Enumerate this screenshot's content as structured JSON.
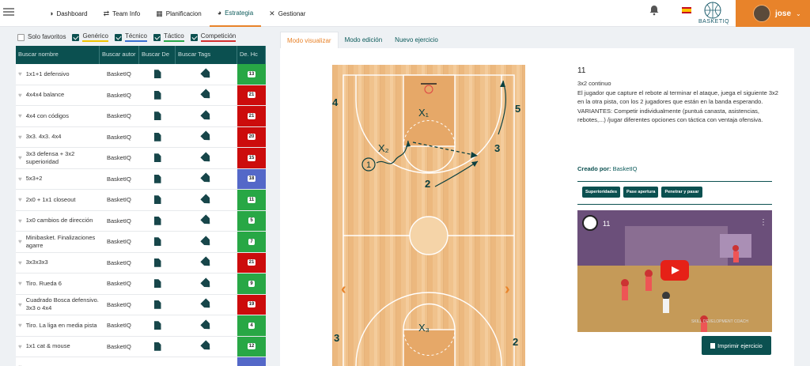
{
  "topbar": {
    "nav": [
      {
        "label": "Dashboard",
        "icon": "dashboard-icon",
        "glyph": "◑"
      },
      {
        "label": "Team Info",
        "icon": "team-info-icon",
        "glyph": "⇄"
      },
      {
        "label": "Planificacion",
        "icon": "calendar-icon",
        "glyph": "▦"
      },
      {
        "label": "Estrategia",
        "icon": "strategy-icon",
        "glyph": "◕"
      },
      {
        "label": "Gestionar",
        "icon": "tools-icon",
        "glyph": "✕"
      }
    ],
    "active_nav": "Estrategia",
    "logo_text": "BASKETIQ",
    "user_name": "jose",
    "user_caret": "⌄"
  },
  "filters": {
    "solo_favoritos": "Solo favoritos",
    "generico": "Genérico",
    "tecnico": "Técnico",
    "tactico": "Táctico",
    "competicion": "Competición"
  },
  "table": {
    "headers": [
      "Buscar nombre",
      "Buscar autor",
      "Buscar De",
      "Buscar Tags",
      "De. Hc"
    ],
    "rows": [
      {
        "name": "1x1+1 defensivo",
        "author": "BasketIQ",
        "difficulty": "13",
        "color": "#28a745"
      },
      {
        "name": "4x4x4 balance",
        "author": "BasketIQ",
        "difficulty": "21",
        "color": "#cc0c0c"
      },
      {
        "name": "4x4 con códigos",
        "author": "BasketIQ",
        "difficulty": "21",
        "color": "#cc0c0c"
      },
      {
        "name": "3x3. 4x3. 4x4",
        "author": "BasketIQ",
        "difficulty": "20",
        "color": "#cc0c0c"
      },
      {
        "name": "3x3 defensa + 3x2 superioridad",
        "author": "BasketIQ",
        "difficulty": "15",
        "color": "#cc0c0c"
      },
      {
        "name": "5x3+2",
        "author": "BasketIQ",
        "difficulty": "18",
        "color": "#5468c8"
      },
      {
        "name": "2x0 + 1x1 closeout",
        "author": "BasketIQ",
        "difficulty": "11",
        "color": "#28a745"
      },
      {
        "name": "1x0 cambios de dirección",
        "author": "BasketIQ",
        "difficulty": "5",
        "color": "#28a745"
      },
      {
        "name": "Minibasket. Finalizaciones agarre",
        "author": "BasketIQ",
        "difficulty": "7",
        "color": "#28a745"
      },
      {
        "name": "3x3x3x3",
        "author": "BasketIQ",
        "difficulty": "21",
        "color": "#cc0c0c"
      },
      {
        "name": "Tiro. Rueda 6",
        "author": "BasketIQ",
        "difficulty": "9",
        "color": "#28a745"
      },
      {
        "name": "Cuadrado Bosca defensivo. 3x3 o 4x4",
        "author": "BasketIQ",
        "difficulty": "19",
        "color": "#cc0c0c"
      },
      {
        "name": "Tiro. La liga en media pista",
        "author": "BasketIQ",
        "difficulty": "4",
        "color": "#28a745"
      },
      {
        "name": "1x1 cat & mouse",
        "author": "BasketIQ",
        "difficulty": "12",
        "color": "#28a745"
      },
      {
        "name": "",
        "author": "",
        "difficulty": "",
        "color": "#5468c8"
      }
    ]
  },
  "tabs": [
    "Modo visualizar",
    "Modo edición",
    "Nuevo ejercicio"
  ],
  "active_tab": "Modo visualizar",
  "court": {
    "labels": {
      "p4": "4",
      "p5": "5",
      "p3": "3",
      "p2": "2",
      "p1": "1",
      "x1": "X₁",
      "x2": "X₂",
      "x3": "X₃",
      "b3": "3",
      "b2": "2"
    }
  },
  "exercise": {
    "number": "11",
    "title": "3x2 continuo",
    "description": "El jugador que capture el rebote al terminar el ataque, juega el siguiente 3x2 en la otra pista, con los 2 jugadores que están en la banda esperando.",
    "variants": "VARIANTES: Competir individualmente (puntuá canasta, asistencias, rebotes,...) /jugar diferentes opciones con táctica con ventaja ofensiva.",
    "creator_label": "Creado por:",
    "creator": "BasketIQ",
    "tags": [
      "Superioridades",
      "Pase apertura",
      "Penetrar y pasar"
    ],
    "video_title": "11",
    "video_watermark": "SKILL DEVELOPMENT COACH",
    "print_label": "Imprimir ejercicio"
  }
}
